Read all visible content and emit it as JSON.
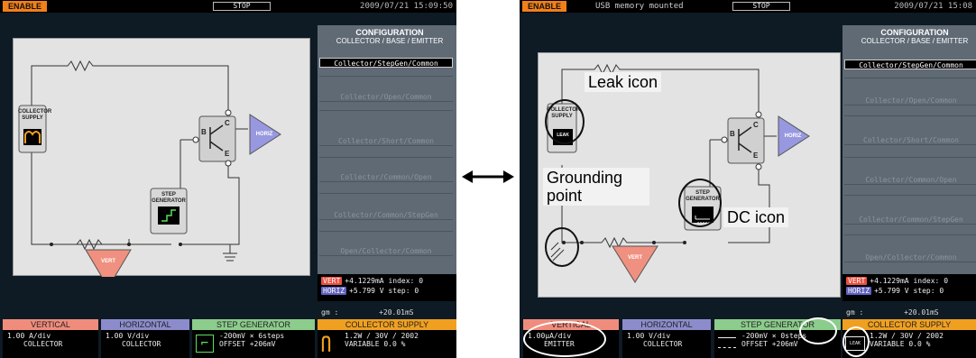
{
  "topbar": {
    "enable": "ENABLE",
    "stop": "STOP",
    "left_datetime": "2009/07/21 15:09:50",
    "right_datetime": "2009/07/21 15:08",
    "usb_status": "USB memory mounted"
  },
  "config": {
    "title": "CONFIGURATION",
    "subtitle_left": "COLLECTOR / BASE / EMITTER",
    "subtitle_right": "COLLECTOR / BASE / EMITTER",
    "items_left": [
      "Collector/StepGen/Common",
      "Collector/Open/Common",
      "Collector/Short/Common",
      "Collector/Common/Open",
      "Collector/Common/StepGen",
      "Open/Collector/Common"
    ],
    "items_right": [
      "Collector/StepGen/Common",
      "Collector/Open/Common",
      "Collector/Short/Common",
      "Collector/Common/Open",
      "Collector/Common/StepGen",
      "Open/Collector/Common"
    ]
  },
  "circuit": {
    "collector_supply": "COLLECTOR SUPPLY",
    "step_generator": "STEP GENERATOR",
    "horiz": "HORIZ",
    "vert": "VERT",
    "b": "B",
    "c": "C",
    "e": "E",
    "leak_label": "LEAK"
  },
  "readout": {
    "vert_tag": "VERT",
    "horiz_tag": "HORIZ",
    "vert_value": "+4.1229mA",
    "horiz_value": "+5.799 V",
    "index_label": "index:",
    "index_value": "0",
    "step_label": "step:",
    "step_value": "0",
    "gm_label": "gm :",
    "gm_value": "+20.01mS"
  },
  "bottom_left": {
    "vertical": {
      "title": "VERTICAL",
      "line1": "1.00 A/div",
      "line2": "COLLECTOR"
    },
    "horizontal": {
      "title": "HORIZONTAL",
      "line1": "1.00 V/div",
      "line2": "COLLECTOR"
    },
    "step": {
      "title": "STEP GENERATOR",
      "line1": "-200mV × 6steps",
      "line2": "OFFSET  +206mV"
    },
    "supply": {
      "title": "COLLECTOR SUPPLY",
      "line1": "1.2W / 30V / 2002",
      "line2": "VARIABLE   0.0 %"
    }
  },
  "bottom_right": {
    "vertical": {
      "title": "VERTICAL",
      "line1": "1.00μA/div",
      "line2": "EMITTER"
    },
    "horizontal": {
      "title": "HORIZONTAL",
      "line1": "1.00 V/div",
      "line2": "COLLECTOR"
    },
    "step": {
      "title": "STEP GENERATOR",
      "line1": "-200mV × 0steps",
      "line2": "OFFSET  +206mV"
    },
    "supply": {
      "title": "COLLECTOR SUPPLY",
      "line1": "1.2W / 30V / 2002",
      "line2": "VARIABLE   0.0 %"
    }
  },
  "annotations": {
    "leak": "Leak icon",
    "ground": "Grounding point",
    "dc": "DC icon"
  },
  "colors": {
    "enable": "#f0801a",
    "vertical": "#f08c7c",
    "horizontal": "#8c8ccc",
    "step": "#8ccc8c",
    "supply": "#f0a020",
    "horiz_triangle": "#9898e0",
    "vert_triangle": "#f09080"
  }
}
